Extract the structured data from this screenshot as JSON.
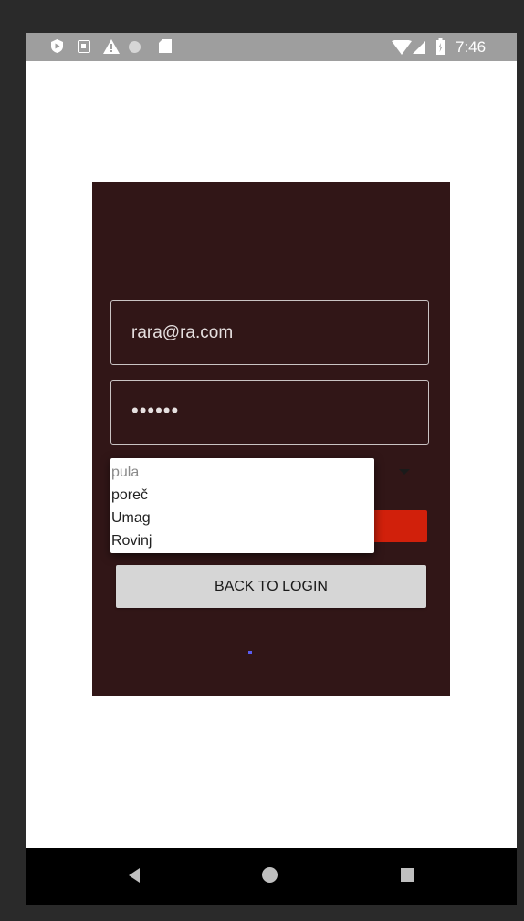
{
  "status_bar": {
    "time": "7:46",
    "icons": [
      "shield-icon",
      "a-box-icon",
      "warning-icon",
      "circle-icon",
      "sd-card-icon",
      "wifi-icon",
      "signal-icon",
      "battery-icon"
    ]
  },
  "form": {
    "email_value": "rara@ra.com",
    "password_value": "••••••",
    "back_button_label": "BACK TO LOGIN"
  },
  "dropdown": {
    "options": [
      "pula",
      "poreč",
      "Umag",
      "Rovinj"
    ]
  },
  "colors": {
    "card_background": "#311617",
    "accent_red": "#d1200b",
    "status_bar": "#9e9e9e"
  }
}
